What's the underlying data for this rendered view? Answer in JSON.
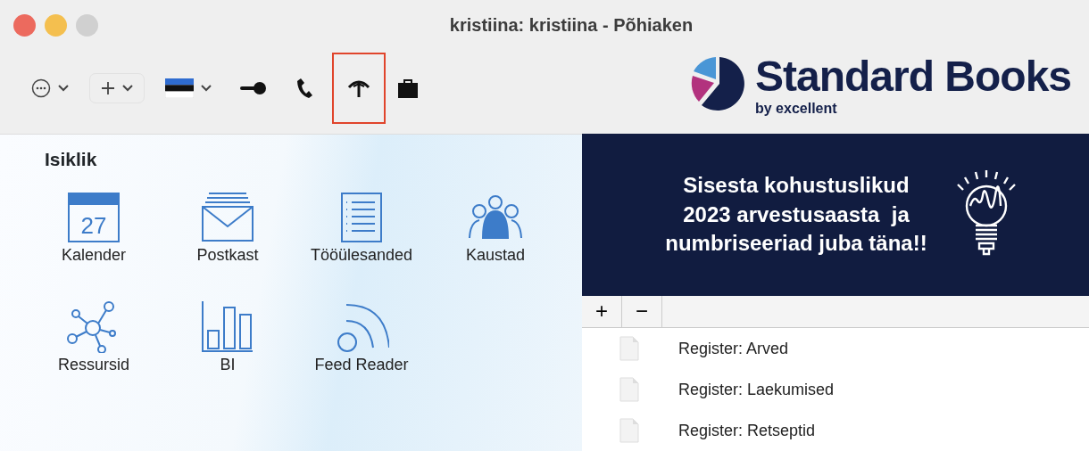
{
  "window": {
    "title": "kristiina: kristiina - Põhiaken"
  },
  "toolbar": [
    {
      "kind": "more",
      "highlighted": false
    },
    {
      "kind": "add",
      "highlighted": false
    },
    {
      "kind": "flag",
      "highlighted": false
    },
    {
      "kind": "key",
      "highlighted": false
    },
    {
      "kind": "phone",
      "highlighted": false
    },
    {
      "kind": "antenna",
      "highlighted": true
    },
    {
      "kind": "briefcase",
      "highlighted": false
    }
  ],
  "logo": {
    "name": "Standard Books",
    "tagline": "by excellent"
  },
  "personal": {
    "heading": "Isiklik",
    "tiles": [
      {
        "kind": "calendar",
        "label": "Kalender",
        "day": "27"
      },
      {
        "kind": "mail",
        "label": "Postkast"
      },
      {
        "kind": "tasks",
        "label": "Tööülesanded"
      },
      {
        "kind": "people",
        "label": "Kaustad"
      },
      {
        "kind": "network",
        "label": "Ressursid"
      },
      {
        "kind": "chart",
        "label": "BI"
      },
      {
        "kind": "feed",
        "label": "Feed Reader"
      }
    ]
  },
  "banner": {
    "lines": [
      "Sisesta kohustuslikud",
      "2023 arvestusaasta  ja",
      "numbriseeriad juba täna!!"
    ]
  },
  "list_toolbar": [
    "+",
    "−"
  ],
  "list": [
    "Register: Arved",
    "Register: Laekumised",
    "Register: Retseptid"
  ]
}
